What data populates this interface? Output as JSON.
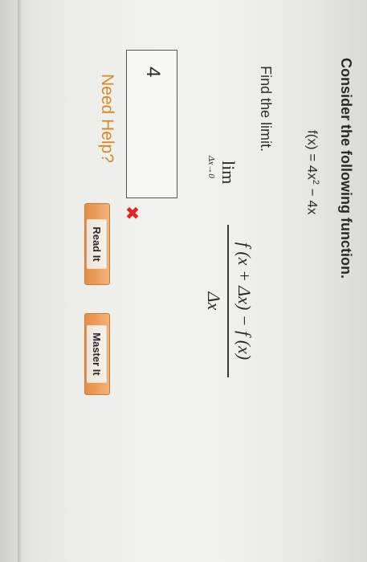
{
  "question": {
    "prompt": "Consider the following function.",
    "function_prefix": "f(x) = 4x",
    "function_exponent": "2",
    "function_suffix": " − 4x",
    "instruction": "Find the limit.",
    "limit_word": "lim",
    "limit_subscript": "Δx→0",
    "numerator": "f (x + Δx) − f (x)",
    "denominator": "Δx"
  },
  "answer": {
    "value": "4",
    "status_mark": "✖"
  },
  "help": {
    "label": "Need Help?",
    "read_it": "Read It",
    "master_it": "Master It"
  },
  "colors": {
    "incorrect": "#e2241c",
    "help_text": "#d58a2a",
    "button_fill": "#ec9a55"
  }
}
